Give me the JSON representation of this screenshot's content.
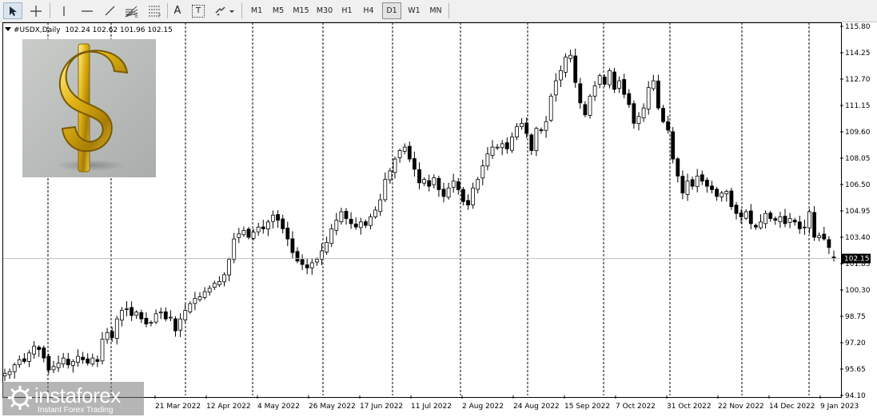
{
  "toolbar": {
    "tools": [
      {
        "name": "cursor-tool",
        "icon": "cursor-icon",
        "selected": true
      },
      {
        "name": "crosshair-tool",
        "icon": "crosshair-icon",
        "selected": false
      },
      {
        "name": "vertical-line-tool",
        "icon": "vertical-line-icon",
        "selected": false
      },
      {
        "name": "horizontal-line-tool",
        "icon": "horizontal-line-icon",
        "selected": false
      },
      {
        "name": "trendline-tool",
        "icon": "trendline-icon",
        "selected": false
      },
      {
        "name": "fibonacci-fan-tool",
        "icon": "fibonacci-fan-icon",
        "selected": false
      },
      {
        "name": "fibonacci-retracement-tool",
        "icon": "fibonacci-retracement-icon",
        "selected": false
      },
      {
        "name": "text-tool",
        "icon": "text-a-icon",
        "selected": false
      },
      {
        "name": "text-label-tool",
        "icon": "text-label-icon",
        "selected": false
      },
      {
        "name": "shapes-dropdown-tool",
        "icon": "shapes-arrows-icon",
        "selected": false
      }
    ],
    "text_tool_label": "A",
    "label_tool_label": "T",
    "timeframes": [
      {
        "label": "M1",
        "selected": false
      },
      {
        "label": "M5",
        "selected": false
      },
      {
        "label": "M15",
        "selected": false
      },
      {
        "label": "M30",
        "selected": false
      },
      {
        "label": "H1",
        "selected": false
      },
      {
        "label": "H4",
        "selected": false
      },
      {
        "label": "D1",
        "selected": true
      },
      {
        "label": "W1",
        "selected": false
      },
      {
        "label": "MN",
        "selected": false
      }
    ]
  },
  "chart_header": {
    "symbol": "#USDX,Daily",
    "ohlc": "102.24 102.62 101.96 102.15"
  },
  "watermark": {
    "brand": "instaforex",
    "tagline": "Instant Forex Trading"
  },
  "thumbnail": {
    "icon": "gold-dollar-sign-icon"
  },
  "colors": {
    "bull_body": "#ffffff",
    "bear_body": "#000000",
    "candle_outline": "#000000",
    "grid_line": "#000000",
    "current_price_line": "#c0c0c0",
    "price_label_bg": "#000000"
  },
  "chart_data": {
    "type": "candlestick",
    "symbol": "#USDX",
    "timeframe": "Daily",
    "ylim": [
      94.1,
      115.8
    ],
    "y_ticks": [
      "115.80",
      "114.25",
      "112.70",
      "111.15",
      "109.60",
      "108.05",
      "106.50",
      "104.95",
      "103.40",
      "101.85",
      "100.30",
      "98.75",
      "97.20",
      "95.65",
      "94.10"
    ],
    "x_tick_labels": [
      "21 Mar 2022",
      "12 Apr 2022",
      "4 May 2022",
      "26 May 2022",
      "17 Jun 2022",
      "11 Jul 2022",
      "2 Aug 2022",
      "24 Aug 2022",
      "15 Sep 2022",
      "7 Oct 2022",
      "31 Oct 2022",
      "22 Nov 2022",
      "14 Dec 2022",
      "9 Jan 2023"
    ],
    "grid": "vertical dotted",
    "last_price": "102.15",
    "last_ohlc": {
      "open": 102.24,
      "high": 102.62,
      "low": 101.96,
      "close": 102.15
    },
    "closes": [
      95.4,
      95.5,
      95.9,
      96.2,
      96.1,
      96.6,
      97.0,
      96.8,
      96.3,
      95.6,
      95.8,
      96.0,
      96.3,
      95.9,
      96.1,
      96.4,
      96.2,
      96.0,
      96.3,
      96.1,
      97.4,
      97.8,
      97.5,
      98.6,
      99.1,
      99.2,
      98.8,
      99.0,
      98.6,
      98.3,
      98.4,
      98.9,
      99.0,
      98.6,
      98.7,
      97.9,
      98.6,
      99.1,
      99.5,
      99.8,
      99.9,
      100.2,
      100.4,
      100.7,
      100.8,
      101.2,
      102.1,
      103.3,
      103.6,
      103.8,
      103.4,
      103.7,
      104.0,
      103.9,
      104.3,
      104.7,
      104.4,
      103.9,
      103.3,
      102.5,
      102.0,
      101.8,
      101.6,
      101.9,
      102.1,
      102.6,
      103.1,
      103.9,
      104.4,
      104.9,
      104.5,
      104.2,
      104.0,
      104.3,
      104.1,
      104.6,
      105.0,
      105.6,
      106.8,
      107.3,
      108.0,
      108.5,
      108.7,
      108.0,
      107.4,
      106.6,
      106.8,
      106.4,
      106.9,
      106.2,
      105.8,
      106.3,
      106.7,
      106.2,
      105.5,
      105.3,
      106.3,
      106.8,
      107.6,
      108.3,
      108.7,
      108.7,
      108.9,
      108.6,
      109.3,
      109.9,
      110.1,
      109.5,
      108.5,
      109.8,
      109.7,
      110.2,
      111.7,
      112.6,
      113.2,
      114.0,
      114.1,
      112.5,
      111.3,
      110.6,
      111.7,
      112.3,
      112.9,
      112.4,
      113.2,
      112.1,
      112.6,
      111.8,
      111.2,
      110.1,
      110.5,
      111.0,
      112.2,
      112.6,
      111.0,
      110.2,
      109.7,
      108.0,
      107.0,
      106.0,
      106.7,
      106.4,
      107.0,
      106.7,
      106.4,
      106.2,
      105.8,
      106.0,
      106.1,
      105.2,
      104.8,
      104.6,
      104.9,
      104.2,
      104.0,
      104.3,
      104.8,
      104.5,
      104.4,
      104.6,
      104.2,
      104.5,
      104.3,
      103.9,
      104.0,
      104.9,
      103.4,
      103.5,
      103.3,
      102.8,
      102.15
    ]
  }
}
